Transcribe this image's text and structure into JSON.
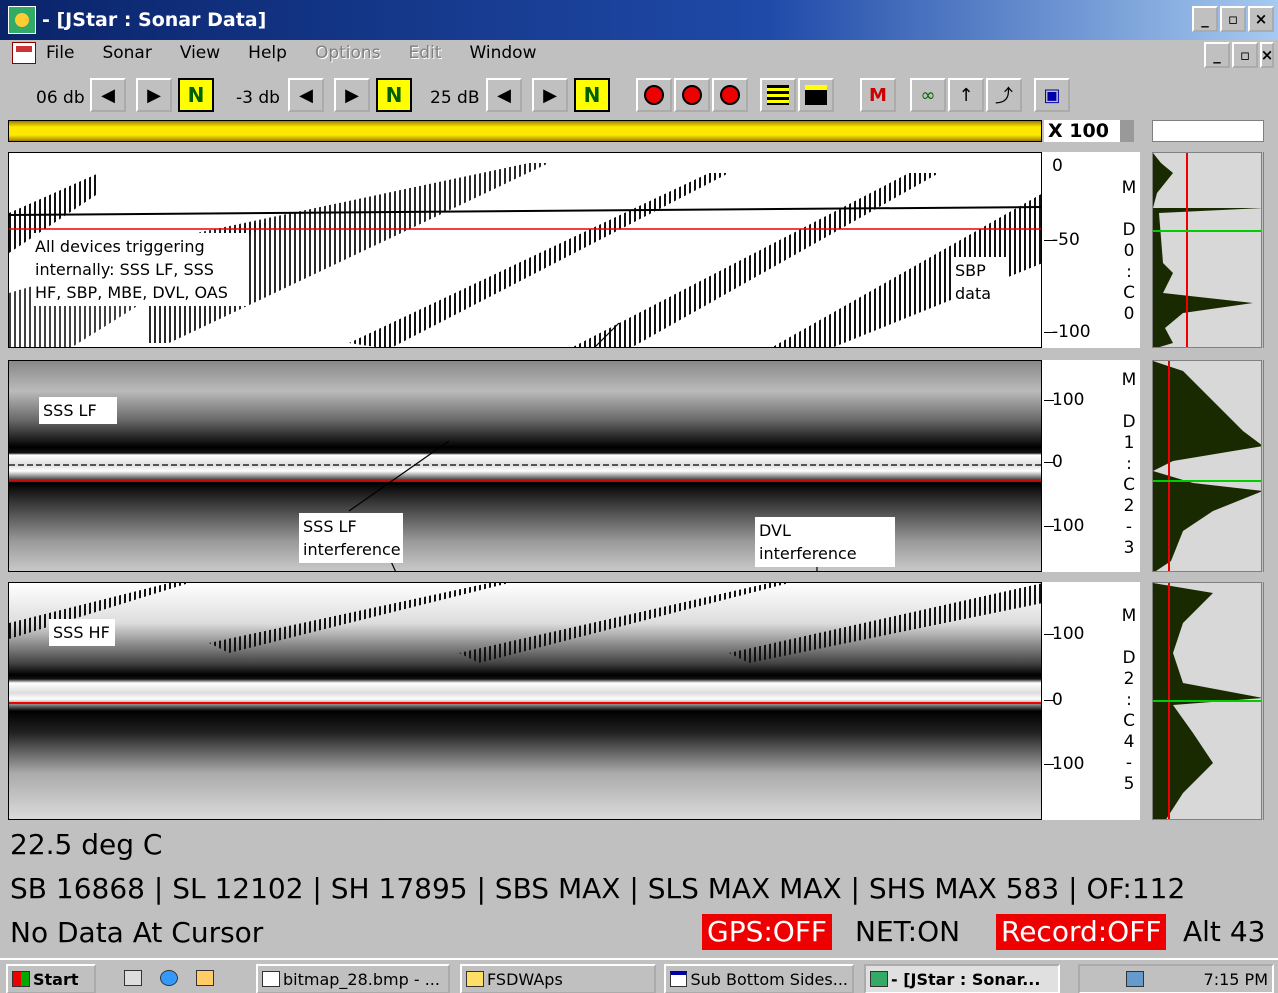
{
  "window": {
    "title": "- [JStar : Sonar Data]",
    "min": "_",
    "max": " ̅",
    "close": "×"
  },
  "menu": [
    "File",
    "Sonar",
    "View",
    "Help",
    "Options",
    "Edit",
    "Window"
  ],
  "menu_disabled": [
    false,
    false,
    false,
    false,
    true,
    true,
    false
  ],
  "toolbar": {
    "gain1": "06 db",
    "gain2": "-3 db",
    "gain3": "25 dB",
    "left": "◀",
    "right": "▶",
    "n": "N",
    "tool_m": "M",
    "tool_glasses": "∞",
    "tool_up": "↑",
    "tool_walk": "⤴",
    "tool_page": "▣"
  },
  "zoom": {
    "label": "X 100"
  },
  "panels": {
    "sbp": {
      "ticks": [
        "0",
        "-50",
        "-100"
      ],
      "vlabel": [
        "M",
        "D",
        "0",
        ":",
        "C",
        "0"
      ],
      "note_devices": [
        "All devices triggering",
        "internally: SSS LF, SSS",
        "HF, SBP, MBE, DVL,  OAS"
      ],
      "note_sbp": [
        "SBP",
        "data"
      ]
    },
    "lf": {
      "ticks": [
        "100",
        "0",
        "100"
      ],
      "vlabel": [
        "M",
        "D",
        "1",
        ":",
        "C",
        "2",
        "-",
        "3"
      ],
      "label": "SSS LF",
      "interf": [
        "SSS LF",
        "interference"
      ],
      "dvl": "DVL interference"
    },
    "hf": {
      "ticks": [
        "100",
        "0",
        "100"
      ],
      "vlabel": [
        "M",
        "D",
        "2",
        ":",
        "C",
        "4",
        "-",
        "5"
      ],
      "label": "SSS HF"
    }
  },
  "status": {
    "temp": "22.5 deg C",
    "line2": "SB 16868 | SL 12102 | SH 17895 | SBS MAX | SLS MAX MAX | SHS MAX 583 | OF:112",
    "cursor": "No Data At Cursor",
    "gps": "GPS:OFF",
    "net": "NET:ON",
    "record": "Record:OFF",
    "alt": "Alt  43"
  },
  "colors": {
    "alert": "#ff0000",
    "accent": "#ffe800",
    "titlebar": "#0a246a"
  },
  "taskbar": {
    "start": "Start",
    "items": [
      "bitmap_28.bmp - ...",
      "FSDWAps",
      "Sub Bottom Sides...",
      "- [JStar : Sonar..."
    ],
    "clock": "7:15 PM"
  }
}
